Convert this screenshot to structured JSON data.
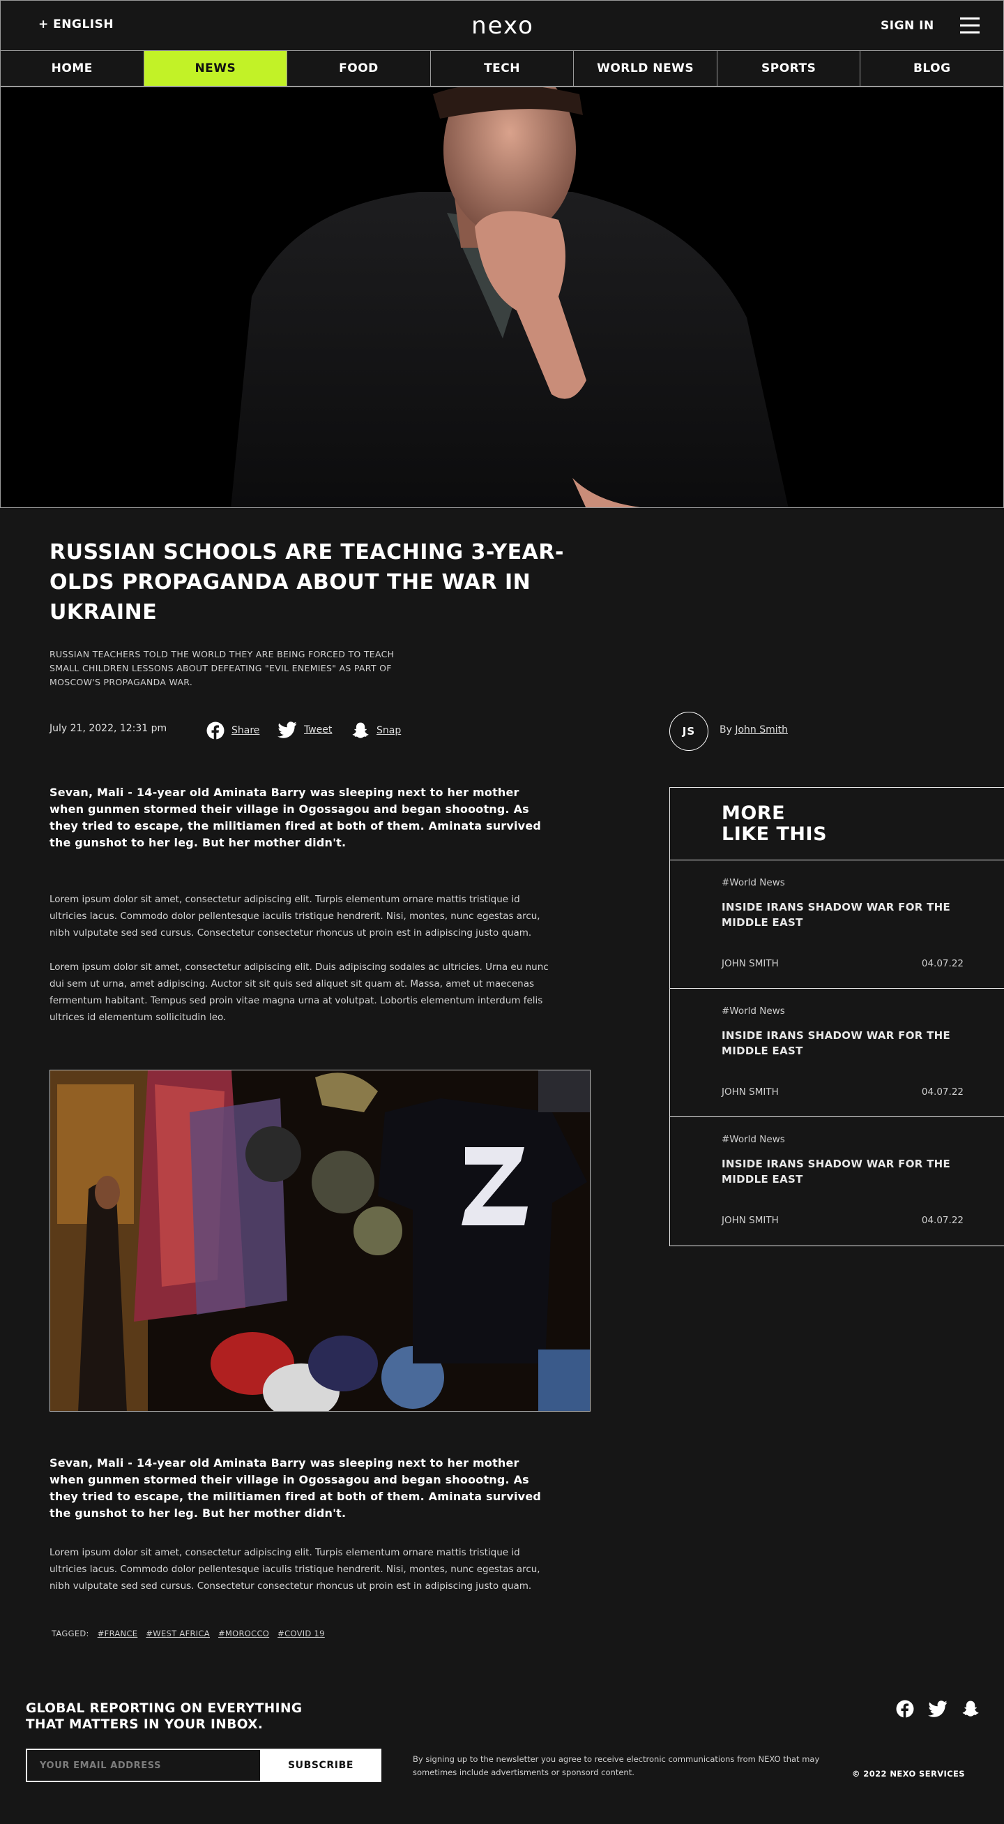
{
  "header": {
    "language": "+ ENGLISH",
    "logo": "nexo",
    "sign_in": "SIGN IN"
  },
  "nav": [
    {
      "label": "HOME",
      "active": false
    },
    {
      "label": "NEWS",
      "active": true
    },
    {
      "label": "FOOD",
      "active": false
    },
    {
      "label": "TECH",
      "active": false
    },
    {
      "label": "WORLD NEWS",
      "active": false
    },
    {
      "label": "SPORTS",
      "active": false
    },
    {
      "label": "BLOG",
      "active": false
    }
  ],
  "article": {
    "headline": "RUSSIAN SCHOOLS ARE TEACHING 3-YEAR-OLDS PROPAGANDA ABOUT THE WAR IN UKRAINE",
    "subhead": "RUSSIAN TEACHERS TOLD THE WORLD THEY ARE BEING FORCED TO TEACH SMALL CHILDREN LESSONS ABOUT DEFEATING \"EVIL ENEMIES\" AS PART OF MOSCOW'S PROPAGANDA WAR.",
    "date": "July 21, 2022, 12:31 pm",
    "share": [
      {
        "icon": "facebook-icon",
        "label": "Share"
      },
      {
        "icon": "twitter-icon",
        "label": "Tweet"
      },
      {
        "icon": "snapchat-icon",
        "label": "Snap"
      }
    ],
    "author_initials": "JS",
    "by": "By",
    "author": "John Smith",
    "lead_1": "Sevan, Mali - 14-year old Aminata Barry was sleeping next to her mother when gunmen stormed their village in Ogossagou and began shoootng. As they tried to escape, the militiamen fired at both of them. Aminata survived the gunshot to her leg. But her mother didn't.",
    "para_1": "Lorem ipsum dolor sit amet, consectetur adipiscing elit. Turpis elementum ornare mattis tristique id ultricies lacus. Commodo dolor pellentesque iaculis tristique hendrerit. Nisi, montes, nunc egestas arcu, nibh vulputate sed sed cursus. Consectetur consectetur rhoncus ut proin est in adipiscing justo quam.",
    "para_2": "Lorem ipsum dolor sit amet, consectetur adipiscing elit. Duis adipiscing sodales ac ultricies. Urna eu nunc dui sem ut urna, amet adipiscing. Auctor sit sit quis sed aliquet sit quam at. Massa, amet ut maecenas fermentum habitant. Tempus sed proin vitae magna urna at volutpat. Lobortis elementum interdum felis ultrices id elementum sollicitudin leo.",
    "lead_2": "Sevan, Mali - 14-year old Aminata Barry was sleeping next to her mother when gunmen stormed their village in Ogossagou and began shoootng. As they tried to escape, the militiamen fired at both of them. Aminata survived the gunshot to her leg. But her mother didn't.",
    "para_3": "Lorem ipsum dolor sit amet, consectetur adipiscing elit. Turpis elementum ornare mattis tristique id ultricies lacus. Commodo dolor pellentesque iaculis tristique hendrerit. Nisi, montes, nunc egestas arcu, nibh vulputate sed sed cursus. Consectetur consectetur rhoncus ut proin est in adipiscing justo quam.",
    "tagged_label": "TAGGED:",
    "tags": [
      "#FRANCE",
      "#WEST AFRICA",
      "#MOROCCO",
      "#COVID 19"
    ]
  },
  "sidebar": {
    "title_line1": "MORE",
    "title_line2": "LIKE THIS",
    "cards": [
      {
        "category": "#World News",
        "title": "INSIDE IRANS SHADOW WAR FOR THE MIDDLE EAST",
        "author": "JOHN SMITH",
        "date": "04.07.22"
      },
      {
        "category": "#World News",
        "title": "INSIDE IRANS SHADOW WAR FOR THE MIDDLE EAST",
        "author": "JOHN SMITH",
        "date": "04.07.22"
      },
      {
        "category": "#World News",
        "title": "INSIDE IRANS SHADOW WAR FOR THE MIDDLE EAST",
        "author": "JOHN SMITH",
        "date": "04.07.22"
      }
    ]
  },
  "footer": {
    "title_line1": "GLOBAL REPORTING ON EVERYTHING",
    "title_line2": "THAT MATTERS IN YOUR INBOX.",
    "email_placeholder": "YOUR EMAIL ADDRESS",
    "subscribe": "SUBSCRIBE",
    "legal": "By signing up to the newsletter you agree to receive electronic communications from NEXO that may sometimes include advertisments or sponsord content.",
    "copyright": "© 2022 NEXO SERVICES",
    "socials": [
      "facebook-icon",
      "twitter-icon",
      "snapchat-icon"
    ]
  },
  "colors": {
    "background": "#161616",
    "accent": "#c2f227",
    "border": "#9a9a9a"
  }
}
